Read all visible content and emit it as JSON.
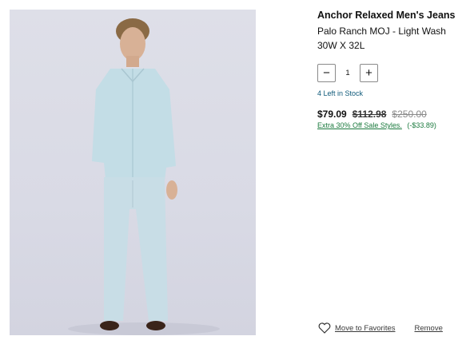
{
  "product": {
    "title": "Anchor Relaxed Men's Jeans",
    "variant": "Palo Ranch MOJ - Light Wash",
    "size": "30W X 32L",
    "image_icon": "model-photo"
  },
  "quantity": {
    "minus_label": "−",
    "value": "1",
    "plus_label": "+"
  },
  "stock_text": "4 Left in Stock",
  "pricing": {
    "sale": "$79.09",
    "was": "$112.98",
    "original": "$250.00",
    "promo_label": "Extra 30% Off Sale Styles.",
    "promo_savings": "(-$33.89)"
  },
  "actions": {
    "favorites_label": "Move to Favorites",
    "remove_label": "Remove"
  },
  "colors": {
    "stock": "#0f5a7a",
    "promo": "#1b7a3e"
  }
}
